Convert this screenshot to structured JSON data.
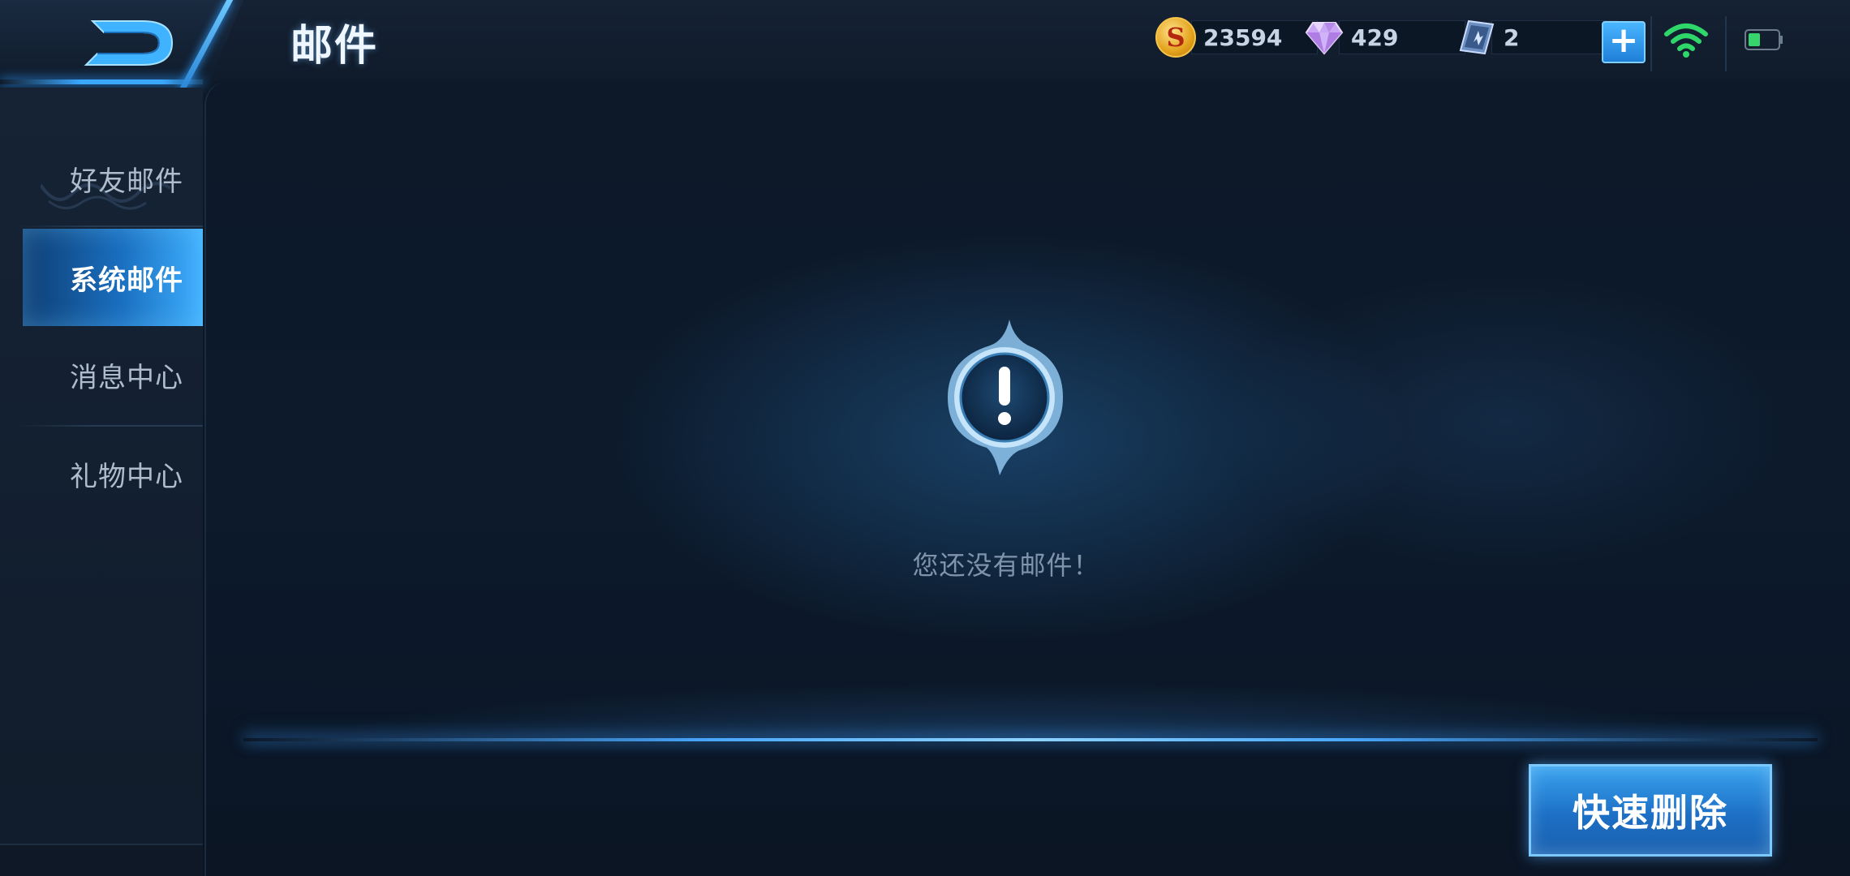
{
  "header": {
    "title": "邮件",
    "back_icon": "back-arrow-icon",
    "currencies": [
      {
        "icon": "gold-coin-icon",
        "value": "23594"
      },
      {
        "icon": "diamond-icon",
        "value": "429"
      },
      {
        "icon": "ticket-icon",
        "value": "2"
      }
    ],
    "add_icon": "plus-icon",
    "status": {
      "wifi": "wifi-icon",
      "battery": "battery-icon"
    }
  },
  "sidebar": {
    "items": [
      {
        "label": "好友邮件",
        "active": false
      },
      {
        "label": "系统邮件",
        "active": true
      },
      {
        "label": "消息中心",
        "active": false
      },
      {
        "label": "礼物中心",
        "active": false
      }
    ]
  },
  "main": {
    "empty_icon": "exclamation-icon",
    "empty_message": "您还没有邮件！",
    "quick_delete_label": "快速删除"
  },
  "colors": {
    "accent": "#3aa8ff",
    "active_tab": "#1a6fc0",
    "wifi": "#2fd66a",
    "battery": "#37d36c",
    "coin": "#e3a21c"
  }
}
